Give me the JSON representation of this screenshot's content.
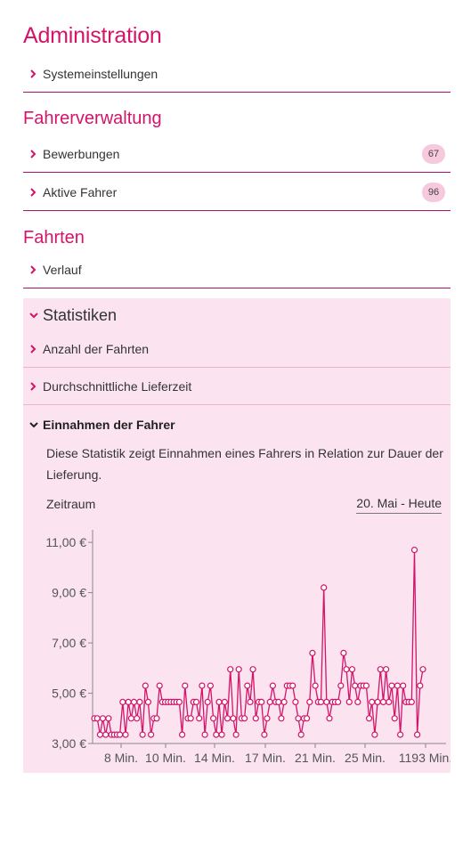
{
  "admin": {
    "title": "Administration",
    "items": [
      {
        "label": "Systemeinstellungen"
      }
    ]
  },
  "drivers": {
    "title": "Fahrerverwaltung",
    "items": [
      {
        "label": "Bewerbungen",
        "badge": "67"
      },
      {
        "label": "Aktive Fahrer",
        "badge": "96"
      }
    ]
  },
  "trips": {
    "title": "Fahrten",
    "items": [
      {
        "label": "Verlauf"
      }
    ]
  },
  "statistics": {
    "title": "Statistiken",
    "items": [
      {
        "label": "Anzahl der Fahrten"
      },
      {
        "label": "Durchschnittliche Lieferzeit"
      }
    ],
    "open": {
      "title": "Einnahmen der Fahrer",
      "description": "Diese Statistik zeigt Einnahmen eines Fahrers in Relation zur Dauer der Lieferung.",
      "range_label": "Zeitraum",
      "range_value": "20. Mai - Heute"
    }
  },
  "colors": {
    "accent": "#d4146a",
    "panel": "#fbe4ef",
    "badge": "#f6c9dc",
    "line": "#d4146a"
  },
  "chart_data": {
    "type": "line",
    "ylim": [
      3,
      11.5
    ],
    "yticks": [
      "3,00 €",
      "5,00 €",
      "7,00 €",
      "9,00 €",
      "11,00 €"
    ],
    "ytick_values": [
      3,
      5,
      7,
      9,
      11
    ],
    "xticks": [
      "8 Min.",
      "10 Min.",
      "14 Min.",
      "17 Min.",
      "21 Min.",
      "25 Min.",
      "1193 Min."
    ],
    "values": [
      4.0,
      4.0,
      3.35,
      4.0,
      3.35,
      4.0,
      3.35,
      3.35,
      3.35,
      3.35,
      4.65,
      3.35,
      4.65,
      4.0,
      4.65,
      4.0,
      4.65,
      3.35,
      5.3,
      4.65,
      3.35,
      4.0,
      4.0,
      5.3,
      4.65,
      4.65,
      4.65,
      4.65,
      4.65,
      4.65,
      4.65,
      3.35,
      5.3,
      4.0,
      4.0,
      4.65,
      4.65,
      4.0,
      5.3,
      3.35,
      4.65,
      5.3,
      4.0,
      3.35,
      4.65,
      3.35,
      4.65,
      4.0,
      5.95,
      4.0,
      3.35,
      5.95,
      4.0,
      4.0,
      5.3,
      4.65,
      5.95,
      4.0,
      4.65,
      4.65,
      3.35,
      4.0,
      4.65,
      5.3,
      4.65,
      4.65,
      4.0,
      4.65,
      5.3,
      5.3,
      5.3,
      4.65,
      4.0,
      3.35,
      4.0,
      4.0,
      4.65,
      6.6,
      5.3,
      4.65,
      4.65,
      9.2,
      4.65,
      4.0,
      4.65,
      4.65,
      4.65,
      5.3,
      6.6,
      5.95,
      4.65,
      5.95,
      5.3,
      4.65,
      5.3,
      5.3,
      5.3,
      4.0,
      4.65,
      3.35,
      4.65,
      5.95,
      4.65,
      5.95,
      4.65,
      5.3,
      4.0,
      5.3,
      3.35,
      5.3,
      4.65,
      4.65,
      4.65,
      10.7,
      3.35,
      5.3,
      5.95
    ]
  }
}
